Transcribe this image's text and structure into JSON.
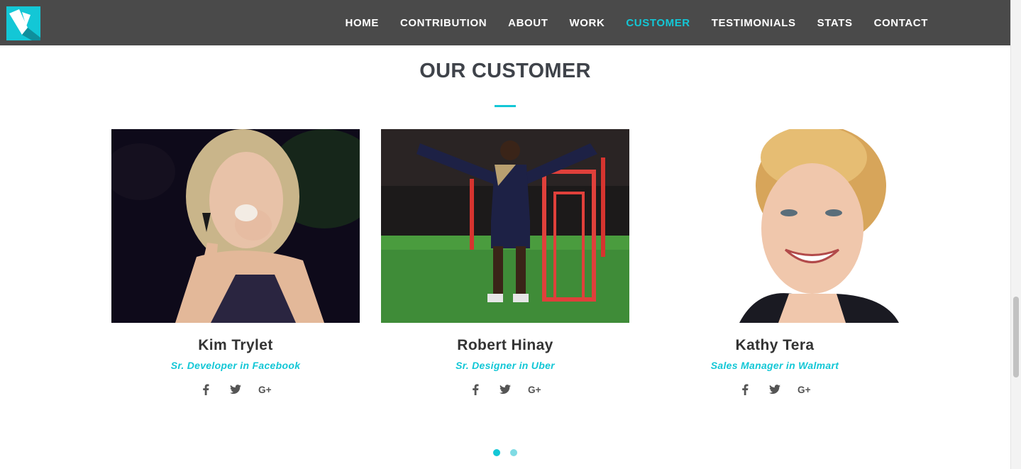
{
  "nav": {
    "items": [
      {
        "label": "HOME",
        "active": false
      },
      {
        "label": "CONTRIBUTION",
        "active": false
      },
      {
        "label": "ABOUT",
        "active": false
      },
      {
        "label": "WORK",
        "active": false
      },
      {
        "label": "CUSTOMER",
        "active": true
      },
      {
        "label": "TESTIMONIALS",
        "active": false
      },
      {
        "label": "STATS",
        "active": false
      },
      {
        "label": "CONTACT",
        "active": false
      }
    ]
  },
  "section": {
    "title": "OUR CUSTOMER"
  },
  "customers": [
    {
      "name": "Kim Trylet",
      "role": "Sr. Developer in Facebook"
    },
    {
      "name": "Robert Hinay",
      "role": "Sr. Designer in Uber"
    },
    {
      "name": "Kathy Tera",
      "role": "Sales Manager in Walmart"
    }
  ],
  "socials": [
    "facebook-icon",
    "twitter-icon",
    "google-plus-icon"
  ],
  "carousel": {
    "pages": 2,
    "active_page": 1
  },
  "colors": {
    "accent": "#13c7d6",
    "navbar": "#4a4a4a",
    "heading": "#3f434a",
    "inactive_dot": "#7fdbe4"
  }
}
